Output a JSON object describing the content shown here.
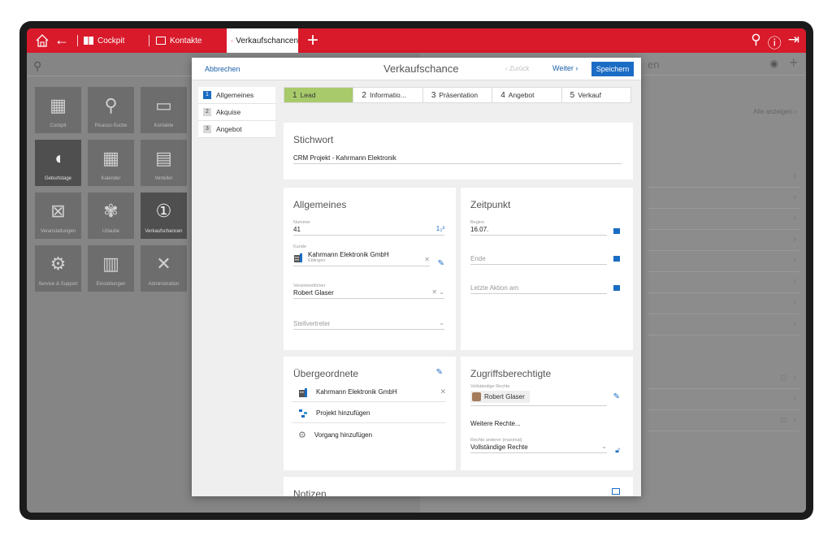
{
  "topbar": {
    "tabs": [
      {
        "label": "Cockpit"
      },
      {
        "label": "Kontakte"
      }
    ],
    "active_tab": "Verkaufschancen"
  },
  "start": {
    "tiles": [
      {
        "label": "Cockpit",
        "icon": "cockpit-icon",
        "glyph": "▦",
        "dark": false
      },
      {
        "label": "Picasso-Suche",
        "icon": "search-icon",
        "glyph": "⚲",
        "dark": false
      },
      {
        "label": "Kontakte",
        "icon": "contact-card-icon",
        "glyph": "▭",
        "dark": false
      },
      {
        "label": "Geburtstage",
        "icon": "balloon-icon",
        "glyph": "◖",
        "dark": true
      },
      {
        "label": "Kalender",
        "icon": "calendar-icon",
        "glyph": "▦",
        "dark": false
      },
      {
        "label": "Verteiler",
        "icon": "distribution-icon",
        "glyph": "▤",
        "dark": false
      },
      {
        "label": "Veranstaltungen",
        "icon": "event-calendar-icon",
        "glyph": "⊠",
        "dark": false
      },
      {
        "label": "Urlaube",
        "icon": "palm-tree-icon",
        "glyph": "✾",
        "dark": false
      },
      {
        "label": "Verkaufschancen",
        "icon": "sales-chance-icon",
        "glyph": "①",
        "dark": true
      },
      {
        "label": "Service & Support",
        "icon": "support-icon",
        "glyph": "⚙",
        "dark": false
      },
      {
        "label": "Einstellungen",
        "icon": "settings-icon",
        "glyph": "▥",
        "dark": false
      },
      {
        "label": "Administration",
        "icon": "tools-icon",
        "glyph": "✕",
        "dark": false
      }
    ]
  },
  "background": {
    "title_fragment": "en",
    "show_all": "Alle anzeigen"
  },
  "modal": {
    "cancel": "Abbrechen",
    "title": "Verkaufschance",
    "back": "Zurück",
    "next": "Weiter",
    "save": "Speichern",
    "nav": [
      {
        "num": "1",
        "label": "Allgemeines"
      },
      {
        "num": "2",
        "label": "Akquise"
      },
      {
        "num": "3",
        "label": "Angebot"
      }
    ],
    "steps": [
      {
        "num": "1",
        "label": "Lead"
      },
      {
        "num": "2",
        "label": "Informatio..."
      },
      {
        "num": "3",
        "label": "Präsentation"
      },
      {
        "num": "4",
        "label": "Angebot"
      },
      {
        "num": "5",
        "label": "Verkauf"
      }
    ],
    "stichwort": {
      "title": "Stichwort",
      "value": "CRM Projekt - Kahrmann Elektronik"
    },
    "allgemeines": {
      "title": "Allgemeines",
      "nummer_label": "Nummer",
      "nummer": "41",
      "nummer_icon": "1₂³",
      "kunde_label": "Kunde",
      "kunde_name": "Kahrmann Elektronik GmbH",
      "kunde_city": "Ettlingen",
      "verantwortlicher_label": "Verantwortlicher",
      "verantwortlicher": "Robert Glaser",
      "stellvertreter": "Stellvertreter"
    },
    "zeitpunkt": {
      "title": "Zeitpunkt",
      "beginn_label": "Beginn",
      "beginn": "16.07.",
      "ende": "Ende",
      "letzte": "Letzte Aktion am"
    },
    "uebergeordnete": {
      "title": "Übergeordnete",
      "items": [
        {
          "label": "Kahrmann Elektronik GmbH"
        },
        {
          "label": "Projekt hinzufügen"
        },
        {
          "label": "Vorgang hinzufügen"
        }
      ]
    },
    "zugriff": {
      "title": "Zugriffsberechtigte",
      "full_label": "Vollständige Rechte",
      "person": "Robert Glaser",
      "more": "Weitere Rechte...",
      "others_label": "Rechte anderer (maximal)",
      "others": "Vollständige Rechte"
    },
    "notizen": {
      "title": "Notizen"
    }
  }
}
